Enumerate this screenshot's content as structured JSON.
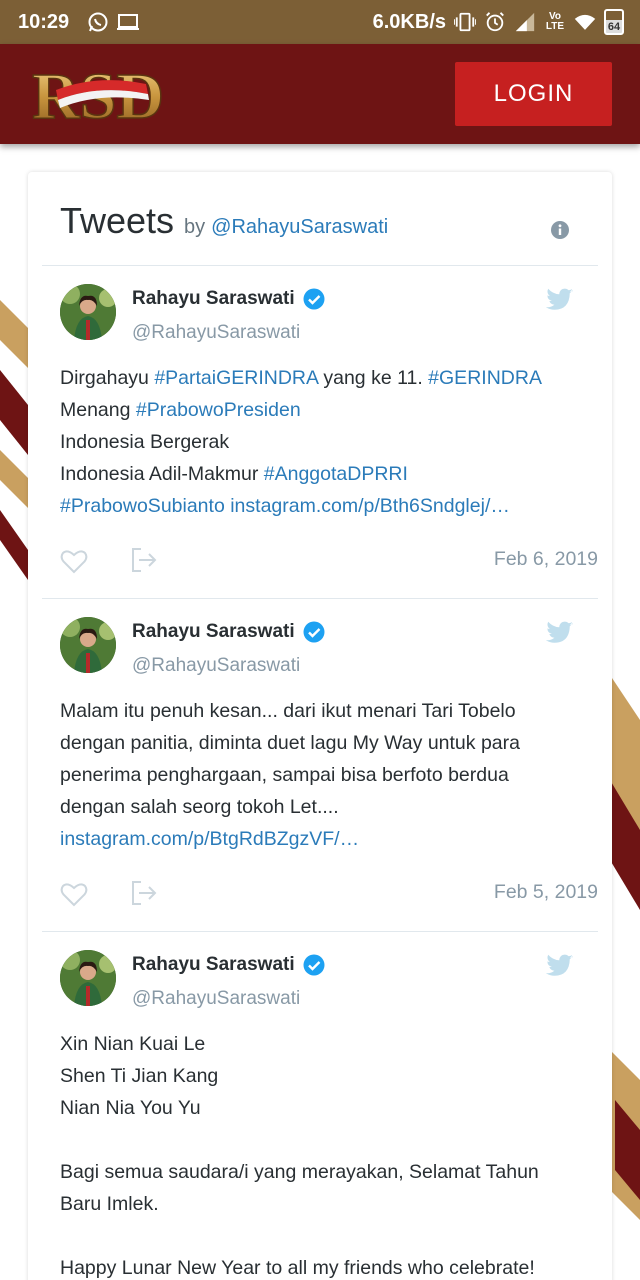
{
  "status_bar": {
    "time": "10:29",
    "network_speed": "6.0KB/s",
    "lte_top": "Vo",
    "lte_bottom": "LTE",
    "battery": "64",
    "icons": [
      "whatsapp-icon",
      "screen-icon",
      "vibrate-icon",
      "alarm-icon",
      "signal-icon",
      "volte-icon",
      "wifi-icon",
      "battery-icon"
    ]
  },
  "header": {
    "logo_text": "RSD",
    "login_label": "LOGIN",
    "background": "#6e1414",
    "button_color": "#c62020"
  },
  "widget": {
    "title": "Tweets",
    "by": "by",
    "handle": "@RahayuSaraswati"
  },
  "tweets": [
    {
      "name": "Rahayu Saraswati",
      "handle": "@RahayuSaraswati",
      "date": "Feb 6, 2019",
      "lines": [
        [
          {
            "t": "Dirgahayu ",
            "tag": false
          },
          {
            "t": "#PartaiGERINDRA",
            "tag": true
          },
          {
            "t": " yang ke 11. ",
            "tag": false
          },
          {
            "t": "#GERINDRA",
            "tag": true
          }
        ],
        [
          {
            "t": "Menang ",
            "tag": false
          },
          {
            "t": "#PrabowoPresiden",
            "tag": true
          }
        ],
        [
          {
            "t": "Indonesia Bergerak",
            "tag": false
          }
        ],
        [
          {
            "t": "Indonesia Adil-Makmur ",
            "tag": false
          },
          {
            "t": "#AnggotaDPRRI",
            "tag": true
          }
        ],
        [
          {
            "t": "#PrabowoSubianto",
            "tag": true
          },
          {
            "t": " ",
            "tag": false
          },
          {
            "t": "instagram.com/p/Bth6Sndglej/…",
            "tag": true
          }
        ]
      ]
    },
    {
      "name": "Rahayu Saraswati",
      "handle": "@RahayuSaraswati",
      "date": "Feb 5, 2019",
      "lines": [
        [
          {
            "t": "Malam itu penuh kesan... dari ikut menari Tari Tobelo",
            "tag": false
          }
        ],
        [
          {
            "t": "dengan panitia, diminta duet lagu My Way untuk para",
            "tag": false
          }
        ],
        [
          {
            "t": "penerima penghargaan, sampai bisa berfoto berdua",
            "tag": false
          }
        ],
        [
          {
            "t": "dengan salah seorg tokoh Let....",
            "tag": false
          }
        ],
        [
          {
            "t": "instagram.com/p/BtgRdBZgzVF/…",
            "tag": true
          }
        ]
      ]
    },
    {
      "name": "Rahayu Saraswati",
      "handle": "@RahayuSaraswati",
      "date": "",
      "lines": [
        [
          {
            "t": "Xin Nian Kuai Le",
            "tag": false
          }
        ],
        [
          {
            "t": "Shen Ti Jian Kang",
            "tag": false
          }
        ],
        [
          {
            "t": "Nian Nia You Yu",
            "tag": false
          }
        ],
        [],
        [
          {
            "t": "Bagi semua saudara/i yang merayakan, Selamat Tahun",
            "tag": false
          }
        ],
        [
          {
            "t": "Baru Imlek.",
            "tag": false
          }
        ],
        [],
        [
          {
            "t": "Happy Lunar New Year to all my friends who celebrate!",
            "tag": false
          }
        ]
      ]
    }
  ]
}
